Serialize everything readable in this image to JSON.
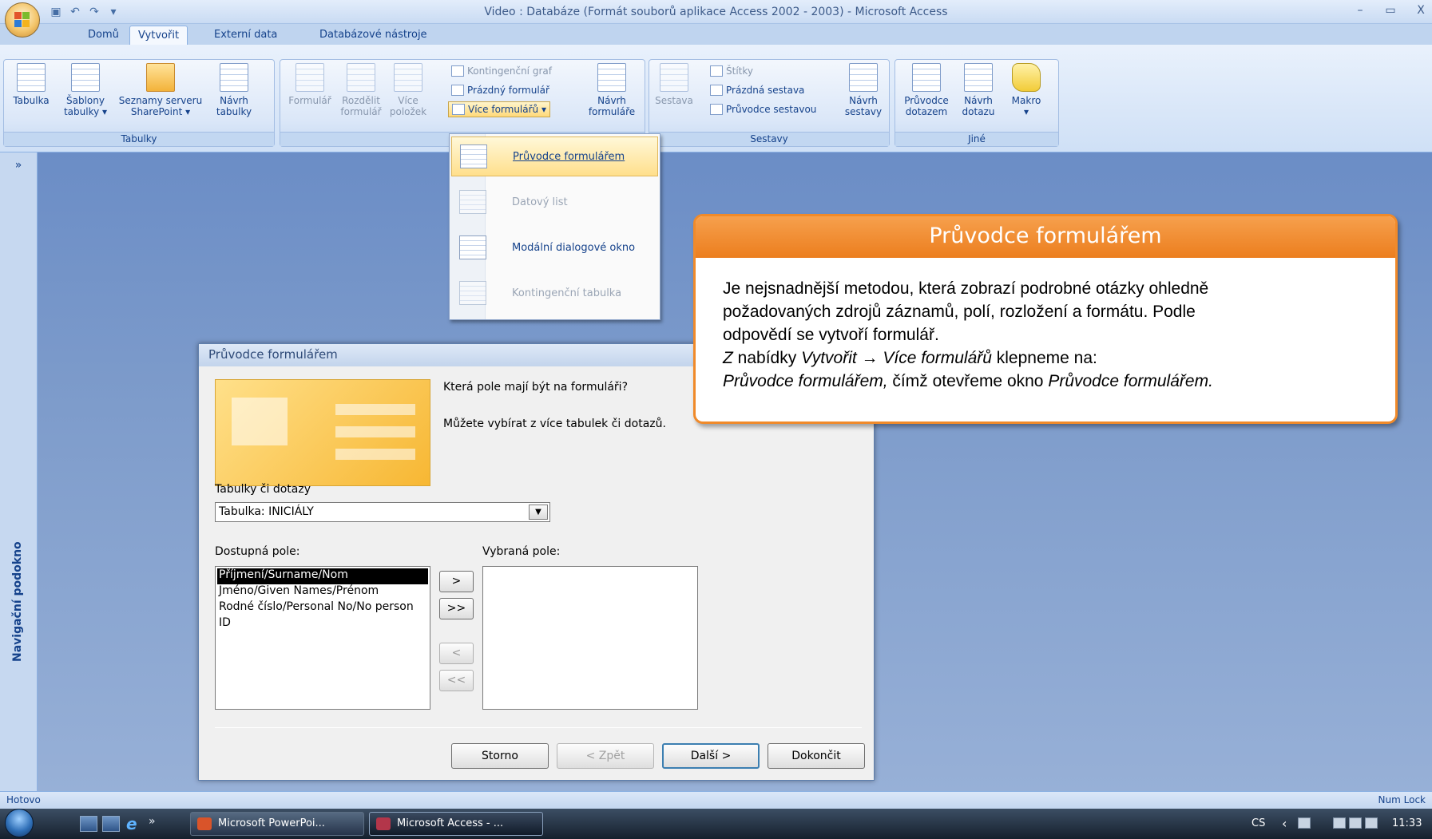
{
  "window": {
    "title": "Video : Databáze (Formát souborů aplikace Access 2002 - 2003) - Microsoft Access",
    "minimize": "–",
    "restore": "▭",
    "close": "X"
  },
  "qat": {
    "save_icon": "save-icon",
    "undo_icon": "undo-icon",
    "redo_icon": "redo-icon"
  },
  "tabs": [
    "Domů",
    "Vytvořit",
    "Externí data",
    "Databázové nástroje"
  ],
  "ribbon": {
    "groups": {
      "tabulky": {
        "label": "Tabulky",
        "buttons": [
          {
            "line1": "Tabulka",
            "line2": ""
          },
          {
            "line1": "Šablony",
            "line2": "tabulky ▾"
          },
          {
            "line1": "Seznamy serveru",
            "line2": "SharePoint ▾"
          },
          {
            "line1": "Návrh",
            "line2": "tabulky"
          }
        ]
      },
      "formulare": {
        "label": "Fo",
        "buttons": [
          {
            "line1": "Formulář",
            "line2": ""
          },
          {
            "line1": "Rozdělit",
            "line2": "formulář"
          },
          {
            "line1": "Více",
            "line2": "položek"
          },
          {
            "line1": "Návrh",
            "line2": "formuláře"
          }
        ],
        "small": [
          "Kontingenční graf",
          "Prázdný formulář",
          "Více formulářů ▾"
        ]
      },
      "sestavy": {
        "label": "Sestavy",
        "buttons": [
          {
            "line1": "Sestava",
            "line2": ""
          },
          {
            "line1": "Návrh",
            "line2": "sestavy"
          }
        ],
        "small": [
          "Štítky",
          "Prázdná sestava",
          "Průvodce sestavou"
        ]
      },
      "jine": {
        "label": "Jiné",
        "buttons": [
          {
            "line1": "Průvodce",
            "line2": "dotazem"
          },
          {
            "line1": "Návrh",
            "line2": "dotazu"
          },
          {
            "line1": "Makro",
            "line2": "▾"
          }
        ]
      }
    }
  },
  "dropdown": {
    "items": [
      {
        "label": "Průvodce formulářem",
        "enabled": true,
        "selected": true
      },
      {
        "label": "Datový list",
        "enabled": false,
        "selected": false
      },
      {
        "label": "Modální dialogové okno",
        "enabled": true,
        "selected": false
      },
      {
        "label": "Kontingenční tabulka",
        "enabled": false,
        "selected": false
      }
    ]
  },
  "navpane": {
    "collapse": "»",
    "label": "Navigační podokno"
  },
  "wizard": {
    "title": "Průvodce formulářem",
    "question": "Která pole mají být na formuláři?",
    "hint": "Můžete vybírat z více tabulek či dotazů.",
    "tables_label": "Tabulky či dotazy",
    "tables_value": "Tabulka: INICIÁLY",
    "available_label": "Dostupná pole:",
    "selected_label": "Vybraná pole:",
    "available_fields": [
      "Příjmení/Surname/Nom",
      "Jméno/Given Names/Prénom",
      "Rodné číslo/Personal No/No person",
      "ID"
    ],
    "move_one": ">",
    "move_all": ">>",
    "remove_one": "<",
    "remove_all": "<<",
    "buttons": {
      "cancel": "Storno",
      "back": "< Zpět",
      "next": "Další >",
      "finish": "Dokončit"
    }
  },
  "callout": {
    "title": "Průvodce formulářem",
    "line1": "Je nejsnadnější metodou, která zobrazí podrobné otázky ohledně",
    "line2": "požadovaných zdrojů záznamů, polí, rozložení a formátu. Podle",
    "line3": "odpovědí se vytvoří formulář.",
    "line4_em1": "Z",
    "line4_t1": " nabídky ",
    "line4_em2": "Vytvořit → Více formulářů",
    "line4_t2": " klepneme na:",
    "line5_em1": "Průvodce formulářem,",
    "line5_t1": " čímž otevřeme okno ",
    "line5_em2": "Průvodce formulářem."
  },
  "status": {
    "left": "Hotovo",
    "right": "Num Lock"
  },
  "taskbar": {
    "more": "»",
    "items": [
      "Microsoft PowerPoi...",
      "Microsoft Access - ..."
    ],
    "lang": "CS",
    "clock": "11:33"
  }
}
